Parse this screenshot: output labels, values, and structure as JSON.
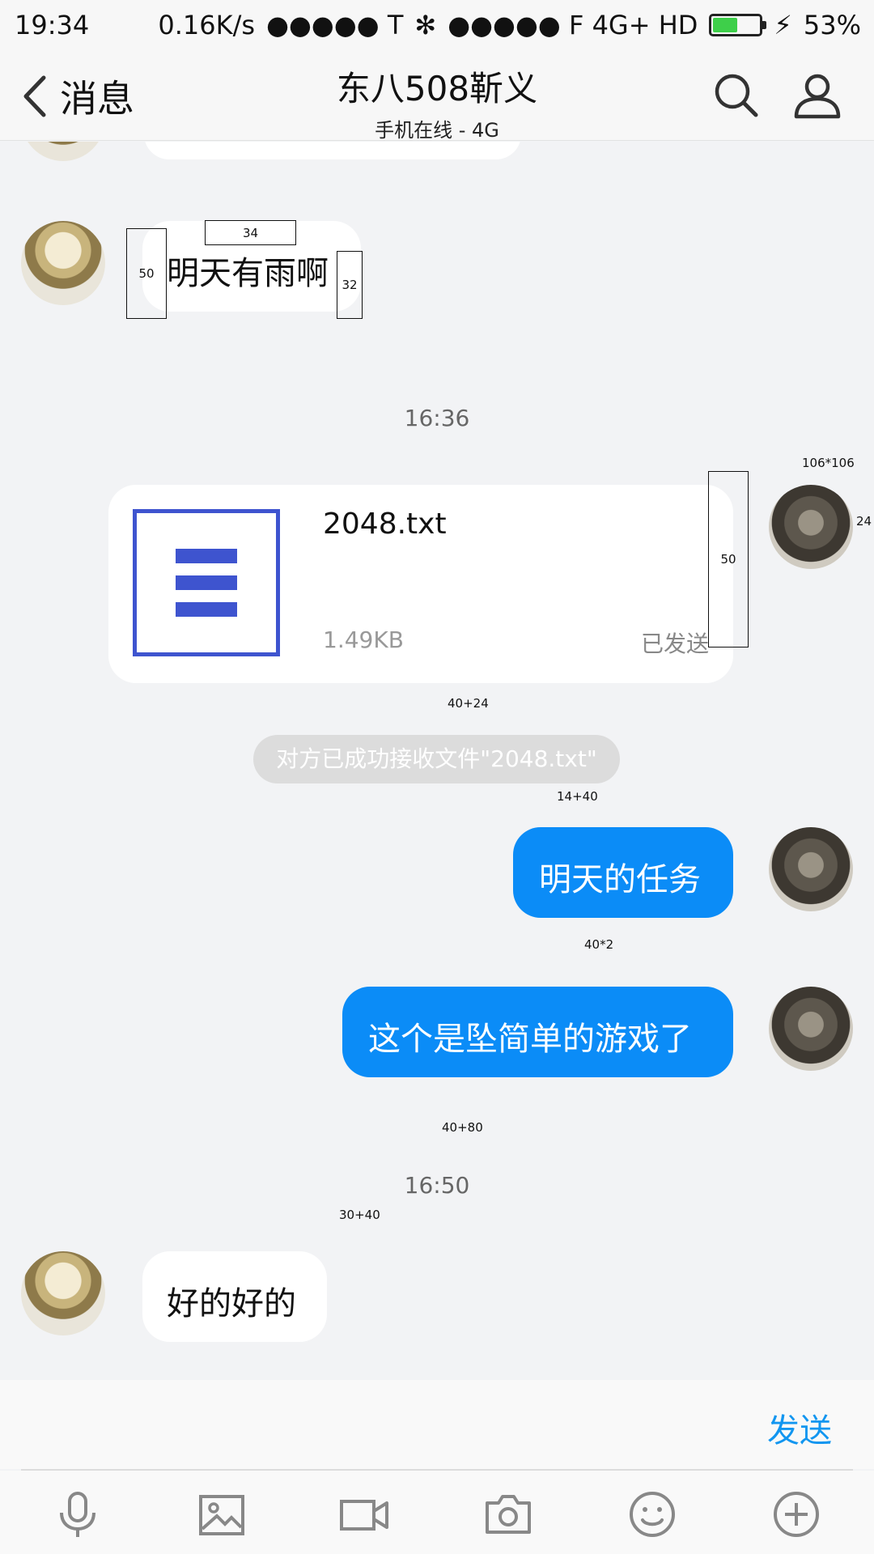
{
  "status_bar": {
    "time": "19:34",
    "net_speed": "0.16K/s",
    "signal1": "●●●●● T",
    "signal2": "●●●●● F 4G+ HD",
    "battery_percent": "53%",
    "battery_level": 53
  },
  "header": {
    "back_label": "消息",
    "title": "东八508靳义",
    "subtitle": "手机在线 - 4G"
  },
  "messages": {
    "m1_text": "明天有雨啊",
    "ts1": "16:36",
    "file": {
      "name": "2048.txt",
      "size": "1.49KB",
      "status": "已发送"
    },
    "system_text": "对方已成功接收文件\"2048.txt\"",
    "m2_text": "明天的任务",
    "m3_text": "这个是坠简单的游戏了",
    "ts2": "16:50",
    "m4_text": "好的好的"
  },
  "annotations": {
    "a_top": "34",
    "a_left1": "50",
    "a_right1": "32",
    "a_avatar": "106*106",
    "a_edge": "24",
    "a_file_pad": "50",
    "a_40_24": "40+24",
    "a_14_40": "14+40",
    "a_40x2": "40*2",
    "a_40_80": "40+80",
    "a_30_40": "30+40"
  },
  "input": {
    "send_label": "发送"
  },
  "colors": {
    "accent": "#0b8cf7",
    "send": "#1296f0",
    "file_icon": "#3e54cf"
  }
}
